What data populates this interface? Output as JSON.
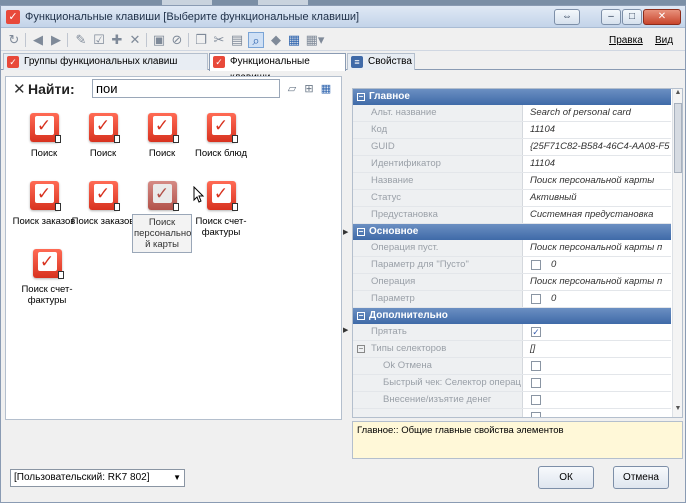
{
  "window": {
    "title": "Функциональные клавиши [Выберите функциональные клавиши]",
    "restore_glyph": "⇔",
    "min_glyph": "–",
    "max_glyph": "□",
    "close_glyph": "✕"
  },
  "menu": {
    "edit": "Правка",
    "view": "Вид"
  },
  "tabs": [
    {
      "label": "Группы функциональных клавиш"
    },
    {
      "label": "Функциональные клавиши"
    },
    {
      "label": "Свойства"
    }
  ],
  "search": {
    "close_glyph": "✕",
    "label": "Найти:",
    "value": "пои"
  },
  "items": [
    {
      "label": "Поиск"
    },
    {
      "label": "Поиск"
    },
    {
      "label": "Поиск"
    },
    {
      "label": "Поиск блюд"
    },
    {
      "label": "Поиск заказов"
    },
    {
      "label": "Поиск заказов"
    },
    {
      "label": "Поиск персонально й карты"
    },
    {
      "label": "Поиск счет-фактуры"
    },
    {
      "label": "Поиск счет-фактуры"
    }
  ],
  "sections": {
    "main": "Главное",
    "basic": "Основное",
    "extra": "Дополнительно"
  },
  "props": {
    "alt_name": {
      "name": "Альт. название",
      "value": "Search of personal card"
    },
    "code": {
      "name": "Код",
      "value": "11104"
    },
    "guid": {
      "name": "GUID",
      "value": "{25F71C82-B584-46C4-AA08-F5"
    },
    "ident": {
      "name": "Идентификатор",
      "value": "11104"
    },
    "title": {
      "name": "Название",
      "value": "Поиск персональной карты"
    },
    "status": {
      "name": "Статус",
      "value": "Активный"
    },
    "preset": {
      "name": "Предустановка",
      "value": "Системная предустановка"
    },
    "op_empty": {
      "name": "Операция пуст.",
      "value": "Поиск персональной карты п"
    },
    "param_empty": {
      "name": "Параметр для \"Пусто\"",
      "value": "0"
    },
    "op": {
      "name": "Операция",
      "value": "Поиск персональной карты п"
    },
    "param": {
      "name": "Параметр",
      "value": "0"
    },
    "hide": {
      "name": "Прятать"
    },
    "selector_types": {
      "name": "Типы селекторов",
      "value": "[]"
    },
    "ok_cancel": {
      "name": "Ok Отмена"
    },
    "fast_check": {
      "name": "Быстрый чек: Селектор операц"
    },
    "cash_in_out": {
      "name": "Внесение/изъятие денег"
    }
  },
  "description": "Главное:: Общие главные свойства элементов",
  "footer": {
    "select_value": "[Пользовательский: RK7 802]",
    "ok": "ОК",
    "cancel": "Отмена"
  }
}
